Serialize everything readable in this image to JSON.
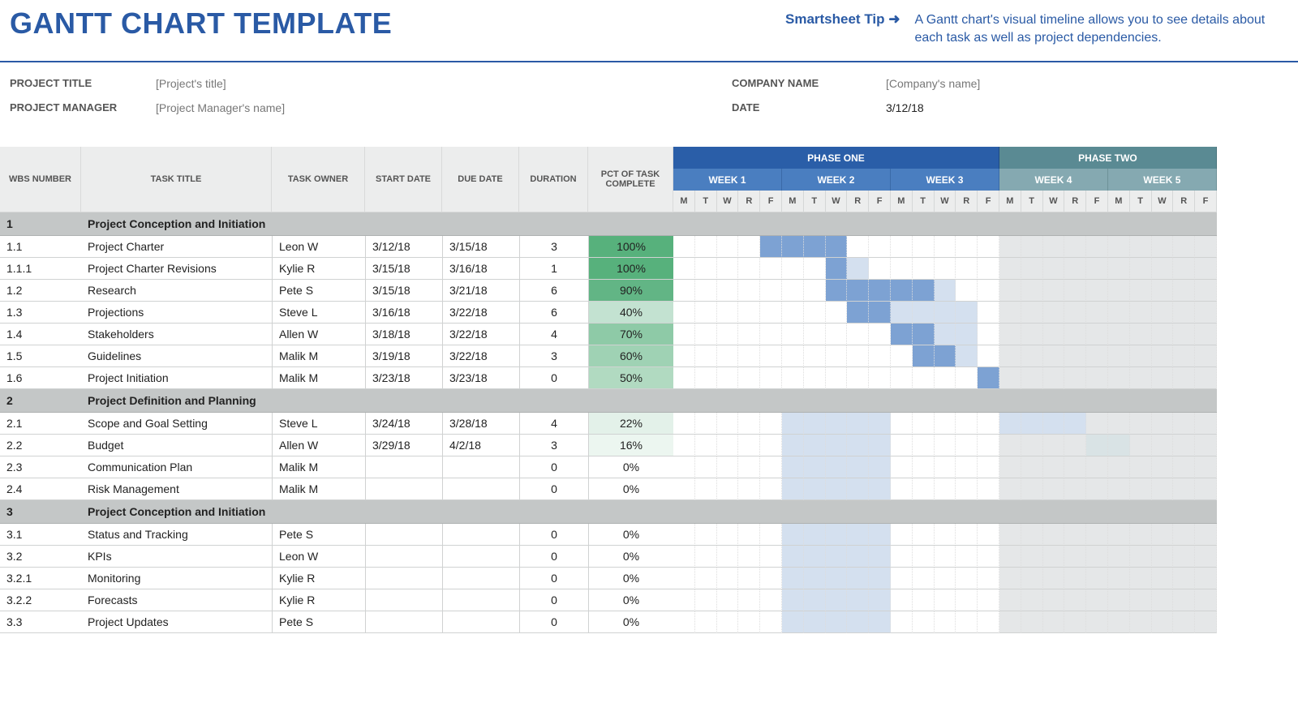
{
  "header": {
    "title": "GANTT CHART TEMPLATE",
    "tip_label": "Smartsheet Tip ➜",
    "tip_text": "A Gantt chart's visual timeline allows you to see details about each task as well as project dependencies."
  },
  "meta": {
    "project_title_label": "PROJECT TITLE",
    "project_title_value": "[Project's title]",
    "project_manager_label": "PROJECT MANAGER",
    "project_manager_value": "[Project Manager's name]",
    "company_name_label": "COMPANY NAME",
    "company_name_value": "[Company's name]",
    "date_label": "DATE",
    "date_value": "3/12/18"
  },
  "columns": {
    "wbs": "WBS NUMBER",
    "title": "TASK TITLE",
    "owner": "TASK OWNER",
    "start": "START DATE",
    "due": "DUE DATE",
    "duration": "DURATION",
    "pct": "PCT OF TASK COMPLETE"
  },
  "phases": [
    "PHASE ONE",
    "PHASE TWO"
  ],
  "weeks": [
    "WEEK 1",
    "WEEK 2",
    "WEEK 3",
    "WEEK 4",
    "WEEK 5"
  ],
  "days": [
    "M",
    "T",
    "W",
    "R",
    "F"
  ],
  "sections": [
    {
      "wbs": "1",
      "title": "Project Conception and Initiation",
      "tasks": [
        {
          "wbs": "1.1",
          "title": "Project Charter",
          "owner": "Leon W",
          "start": "3/12/18",
          "due": "3/15/18",
          "dur": "3",
          "pct": "100%",
          "pctbg": "#57b17c",
          "bar": [
            4,
            5,
            6,
            7
          ]
        },
        {
          "wbs": "1.1.1",
          "title": "Project Charter Revisions",
          "owner": "Kylie R",
          "start": "3/15/18",
          "due": "3/16/18",
          "dur": "1",
          "pct": "100%",
          "pctbg": "#57b17c",
          "bar": [
            7
          ],
          "light": [
            8
          ]
        },
        {
          "wbs": "1.2",
          "title": "Research",
          "owner": "Pete S",
          "start": "3/15/18",
          "due": "3/21/18",
          "dur": "6",
          "pct": "90%",
          "pctbg": "#62b585",
          "bar": [
            7,
            8,
            9,
            10,
            11
          ],
          "light": [
            12
          ]
        },
        {
          "wbs": "1.3",
          "title": "Projections",
          "owner": "Steve L",
          "start": "3/16/18",
          "due": "3/22/18",
          "dur": "6",
          "pct": "40%",
          "pctbg": "#c3e2d1",
          "bar": [
            8,
            9
          ],
          "light": [
            10,
            11,
            12,
            13
          ]
        },
        {
          "wbs": "1.4",
          "title": "Stakeholders",
          "owner": "Allen W",
          "start": "3/18/18",
          "due": "3/22/18",
          "dur": "4",
          "pct": "70%",
          "pctbg": "#8ecaa7",
          "bar": [
            10,
            11
          ],
          "light": [
            12,
            13
          ]
        },
        {
          "wbs": "1.5",
          "title": "Guidelines",
          "owner": "Malik M",
          "start": "3/19/18",
          "due": "3/22/18",
          "dur": "3",
          "pct": "60%",
          "pctbg": "#9fd2b4",
          "bar": [
            11,
            12
          ],
          "light": [
            13
          ]
        },
        {
          "wbs": "1.6",
          "title": "Project Initiation",
          "owner": "Malik M",
          "start": "3/23/18",
          "due": "3/23/18",
          "dur": "0",
          "pct": "50%",
          "pctbg": "#b1dac1",
          "bar": [
            14
          ]
        }
      ]
    },
    {
      "wbs": "2",
      "title": "Project Definition and Planning",
      "tasks": [
        {
          "wbs": "2.1",
          "title": "Scope and Goal Setting",
          "owner": "Steve L",
          "start": "3/24/18",
          "due": "3/28/18",
          "dur": "4",
          "pct": "22%",
          "pctbg": "#e3f1e9",
          "bar": [],
          "light": [
            15,
            16,
            17,
            18
          ]
        },
        {
          "wbs": "2.2",
          "title": "Budget",
          "owner": "Allen W",
          "start": "3/29/18",
          "due": "4/2/18",
          "dur": "3",
          "pct": "16%",
          "pctbg": "#ecf6f0",
          "bar": [],
          "grey2": [
            19,
            20
          ]
        },
        {
          "wbs": "2.3",
          "title": "Communication Plan",
          "owner": "Malik M",
          "start": "",
          "due": "",
          "dur": "0",
          "pct": "0%",
          "pctbg": "#ffffff",
          "bar": []
        },
        {
          "wbs": "2.4",
          "title": "Risk Management",
          "owner": "Malik M",
          "start": "",
          "due": "",
          "dur": "0",
          "pct": "0%",
          "pctbg": "#ffffff",
          "bar": []
        }
      ]
    },
    {
      "wbs": "3",
      "title": "Project Conception and Initiation",
      "tasks": [
        {
          "wbs": "3.1",
          "title": "Status and Tracking",
          "owner": "Pete S",
          "start": "",
          "due": "",
          "dur": "0",
          "pct": "0%",
          "pctbg": "#ffffff",
          "bar": []
        },
        {
          "wbs": "3.2",
          "title": "KPIs",
          "owner": "Leon W",
          "start": "",
          "due": "",
          "dur": "0",
          "pct": "0%",
          "pctbg": "#ffffff",
          "bar": []
        },
        {
          "wbs": "3.2.1",
          "title": "Monitoring",
          "owner": "Kylie R",
          "start": "",
          "due": "",
          "dur": "0",
          "pct": "0%",
          "pctbg": "#ffffff",
          "bar": []
        },
        {
          "wbs": "3.2.2",
          "title": "Forecasts",
          "owner": "Kylie R",
          "start": "",
          "due": "",
          "dur": "0",
          "pct": "0%",
          "pctbg": "#ffffff",
          "bar": []
        },
        {
          "wbs": "3.3",
          "title": "Project Updates",
          "owner": "Pete S",
          "start": "",
          "due": "",
          "dur": "0",
          "pct": "0%",
          "pctbg": "#ffffff",
          "bar": []
        }
      ]
    }
  ],
  "chart_data": {
    "type": "gantt",
    "title": "Gantt Chart Template",
    "start_date": "3/12/18",
    "days_per_week": 5,
    "day_labels": [
      "M",
      "T",
      "W",
      "R",
      "F"
    ],
    "phases": [
      {
        "name": "PHASE ONE",
        "weeks": [
          "WEEK 1",
          "WEEK 2",
          "WEEK 3"
        ]
      },
      {
        "name": "PHASE TWO",
        "weeks": [
          "WEEK 4",
          "WEEK 5"
        ]
      }
    ],
    "tasks": [
      {
        "wbs": "1",
        "title": "Project Conception and Initiation",
        "is_section": true
      },
      {
        "wbs": "1.1",
        "title": "Project Charter",
        "owner": "Leon W",
        "start": "3/12/18",
        "due": "3/15/18",
        "duration": 3,
        "pct_complete": 100
      },
      {
        "wbs": "1.1.1",
        "title": "Project Charter Revisions",
        "owner": "Kylie R",
        "start": "3/15/18",
        "due": "3/16/18",
        "duration": 1,
        "pct_complete": 100
      },
      {
        "wbs": "1.2",
        "title": "Research",
        "owner": "Pete S",
        "start": "3/15/18",
        "due": "3/21/18",
        "duration": 6,
        "pct_complete": 90
      },
      {
        "wbs": "1.3",
        "title": "Projections",
        "owner": "Steve L",
        "start": "3/16/18",
        "due": "3/22/18",
        "duration": 6,
        "pct_complete": 40
      },
      {
        "wbs": "1.4",
        "title": "Stakeholders",
        "owner": "Allen W",
        "start": "3/18/18",
        "due": "3/22/18",
        "duration": 4,
        "pct_complete": 70
      },
      {
        "wbs": "1.5",
        "title": "Guidelines",
        "owner": "Malik M",
        "start": "3/19/18",
        "due": "3/22/18",
        "duration": 3,
        "pct_complete": 60
      },
      {
        "wbs": "1.6",
        "title": "Project Initiation",
        "owner": "Malik M",
        "start": "3/23/18",
        "due": "3/23/18",
        "duration": 0,
        "pct_complete": 50
      },
      {
        "wbs": "2",
        "title": "Project Definition and Planning",
        "is_section": true
      },
      {
        "wbs": "2.1",
        "title": "Scope and Goal Setting",
        "owner": "Steve L",
        "start": "3/24/18",
        "due": "3/28/18",
        "duration": 4,
        "pct_complete": 22
      },
      {
        "wbs": "2.2",
        "title": "Budget",
        "owner": "Allen W",
        "start": "3/29/18",
        "due": "4/2/18",
        "duration": 3,
        "pct_complete": 16
      },
      {
        "wbs": "2.3",
        "title": "Communication Plan",
        "owner": "Malik M",
        "start": "",
        "due": "",
        "duration": 0,
        "pct_complete": 0
      },
      {
        "wbs": "2.4",
        "title": "Risk Management",
        "owner": "Malik M",
        "start": "",
        "due": "",
        "duration": 0,
        "pct_complete": 0
      },
      {
        "wbs": "3",
        "title": "Project Conception and Initiation",
        "is_section": true
      },
      {
        "wbs": "3.1",
        "title": "Status and Tracking",
        "owner": "Pete S",
        "start": "",
        "due": "",
        "duration": 0,
        "pct_complete": 0
      },
      {
        "wbs": "3.2",
        "title": "KPIs",
        "owner": "Leon W",
        "start": "",
        "due": "",
        "duration": 0,
        "pct_complete": 0
      },
      {
        "wbs": "3.2.1",
        "title": "Monitoring",
        "owner": "Kylie R",
        "start": "",
        "due": "",
        "duration": 0,
        "pct_complete": 0
      },
      {
        "wbs": "3.2.2",
        "title": "Forecasts",
        "owner": "Kylie R",
        "start": "",
        "due": "",
        "duration": 0,
        "pct_complete": 0
      },
      {
        "wbs": "3.3",
        "title": "Project Updates",
        "owner": "Pete S",
        "start": "",
        "due": "",
        "duration": 0,
        "pct_complete": 0
      }
    ]
  }
}
